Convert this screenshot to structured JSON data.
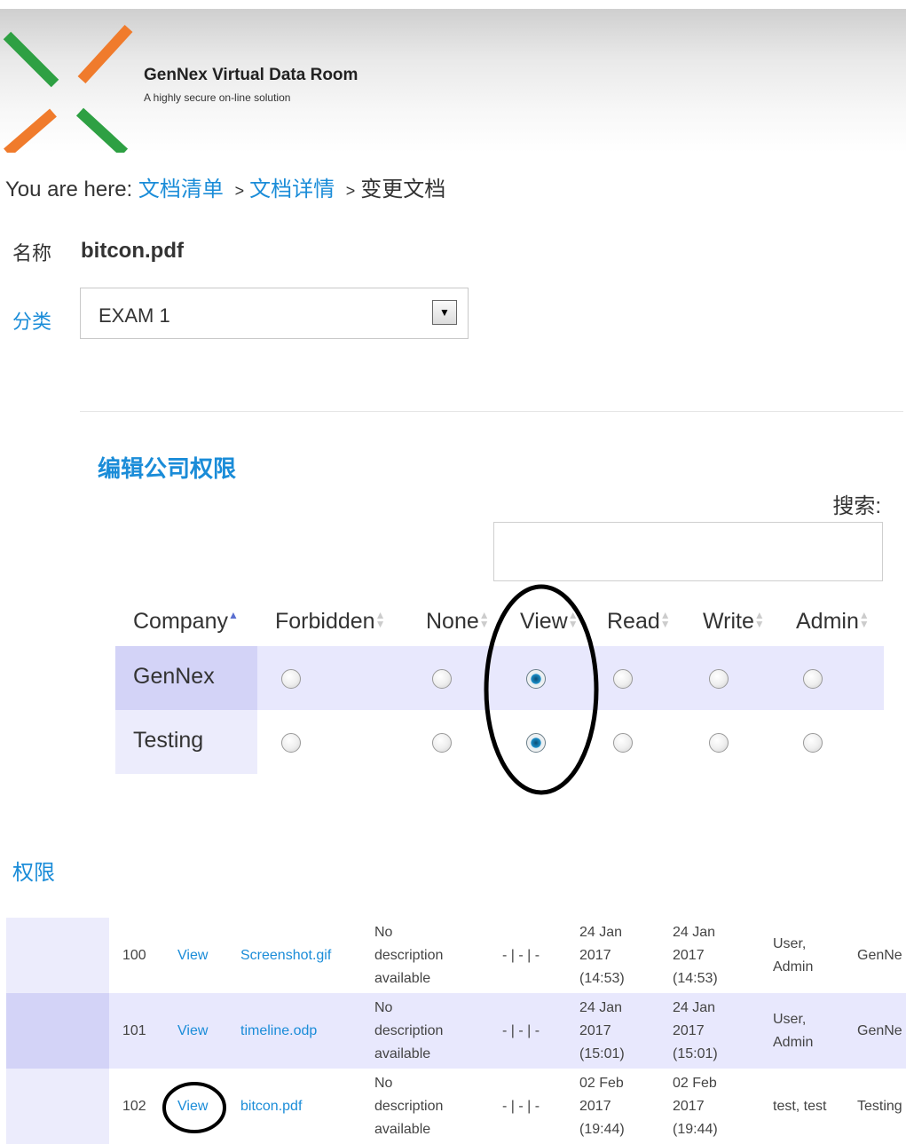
{
  "header": {
    "title": "GenNex Virtual Data Room",
    "subtitle": "A highly secure on-line solution"
  },
  "breadcrumb": {
    "prefix": "You are here:",
    "crumb1": "文档清单",
    "sep1": ">",
    "crumb2": "文档详情",
    "sep2": ">",
    "current": "变更文档"
  },
  "document": {
    "name_label": "名称",
    "name_value": "bitcon.pdf",
    "category_label": "分类",
    "category_value": "EXAM 1"
  },
  "company_permissions": {
    "title": "编辑公司权限",
    "search_label": "搜索:",
    "search_value": "",
    "columns": [
      "Company",
      "Forbidden",
      "None",
      "View",
      "Read",
      "Write",
      "Admin"
    ],
    "rows": [
      {
        "company": "GenNex",
        "selected": "View"
      },
      {
        "company": "Testing",
        "selected": "View"
      }
    ]
  },
  "permissions_section": {
    "title": "权限",
    "rows": [
      {
        "id": "100",
        "action": "View",
        "file": "Screenshot.gif",
        "desc": [
          "No",
          "description",
          "available"
        ],
        "flags": "- | - | -",
        "created": [
          "24 Jan",
          "2017",
          "(14:53)"
        ],
        "modified": [
          "24 Jan",
          "2017",
          "(14:53)"
        ],
        "user": [
          "User,",
          "Admin"
        ],
        "company": "GenNe"
      },
      {
        "id": "101",
        "action": "View",
        "file": "timeline.odp",
        "desc": [
          "No",
          "description",
          "available"
        ],
        "flags": "- | - | -",
        "created": [
          "24 Jan",
          "2017",
          "(15:01)"
        ],
        "modified": [
          "24 Jan",
          "2017",
          "(15:01)"
        ],
        "user": [
          "User,",
          "Admin"
        ],
        "company": "GenNe"
      },
      {
        "id": "102",
        "action": "View",
        "file": "bitcon.pdf",
        "desc": [
          "No",
          "description",
          "available"
        ],
        "flags": "- | - | -",
        "created": [
          "02 Feb",
          "2017",
          "(19:44)"
        ],
        "modified": [
          "02 Feb",
          "2017",
          "(19:44)"
        ],
        "user": [
          "test, test"
        ],
        "company": "Testing"
      }
    ]
  },
  "colors": {
    "accent": "#1a8cd8",
    "logo_green": "#2ea043",
    "logo_orange": "#f07b2c",
    "row_highlight": "#e8e8fd"
  }
}
